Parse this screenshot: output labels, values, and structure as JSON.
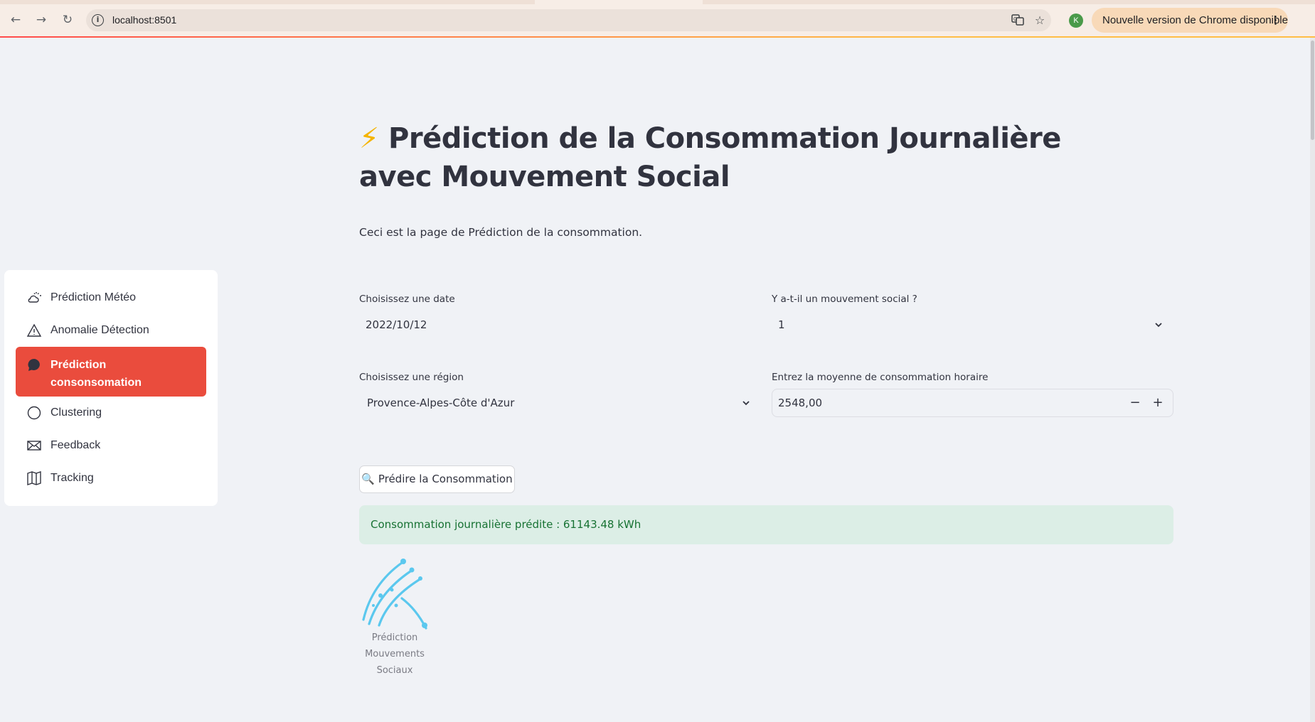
{
  "browser": {
    "url": "localhost:8501",
    "profile_initial": "K",
    "update_label": "Nouvelle version de Chrome disponible"
  },
  "sidebar": {
    "items": [
      {
        "label": "Prédiction Météo",
        "icon": "cloud-sun-icon"
      },
      {
        "label": "Anomalie Détection",
        "icon": "warning-triangle-icon"
      },
      {
        "label": "Prédiction consonsomation",
        "icon": "chat-bubble-icon",
        "active": true
      },
      {
        "label": "Clustering",
        "icon": "circle-icon"
      },
      {
        "label": "Feedback",
        "icon": "envelope-icon"
      },
      {
        "label": "Tracking",
        "icon": "map-icon"
      }
    ]
  },
  "main": {
    "title_emoji": "⚡",
    "title_text": "Prédiction de la Consommation Journalière avec Mouvement Social",
    "intro": "Ceci est la page de Prédiction de la consommation.",
    "date_label": "Choisissez une date",
    "date_value": "2022/10/12",
    "social_label": "Y a-t-il un mouvement social ?",
    "social_value": "1",
    "region_label": "Choisissez une région",
    "region_value": "Provence-Alpes-Côte d'Azur",
    "avg_label": "Entrez la moyenne de consommation horaire",
    "avg_value": "2548,00",
    "predict_button": "🔍 Prédire la Consommation",
    "result_text": "Consommation journalière prédite : 61143.48 kWh",
    "logo_caption": "Prédiction Mouvements Sociaux"
  },
  "colors": {
    "accent": "#ea4c3d",
    "success_bg": "#dceee6",
    "success_text": "#177233",
    "background": "#f0f2f6"
  }
}
